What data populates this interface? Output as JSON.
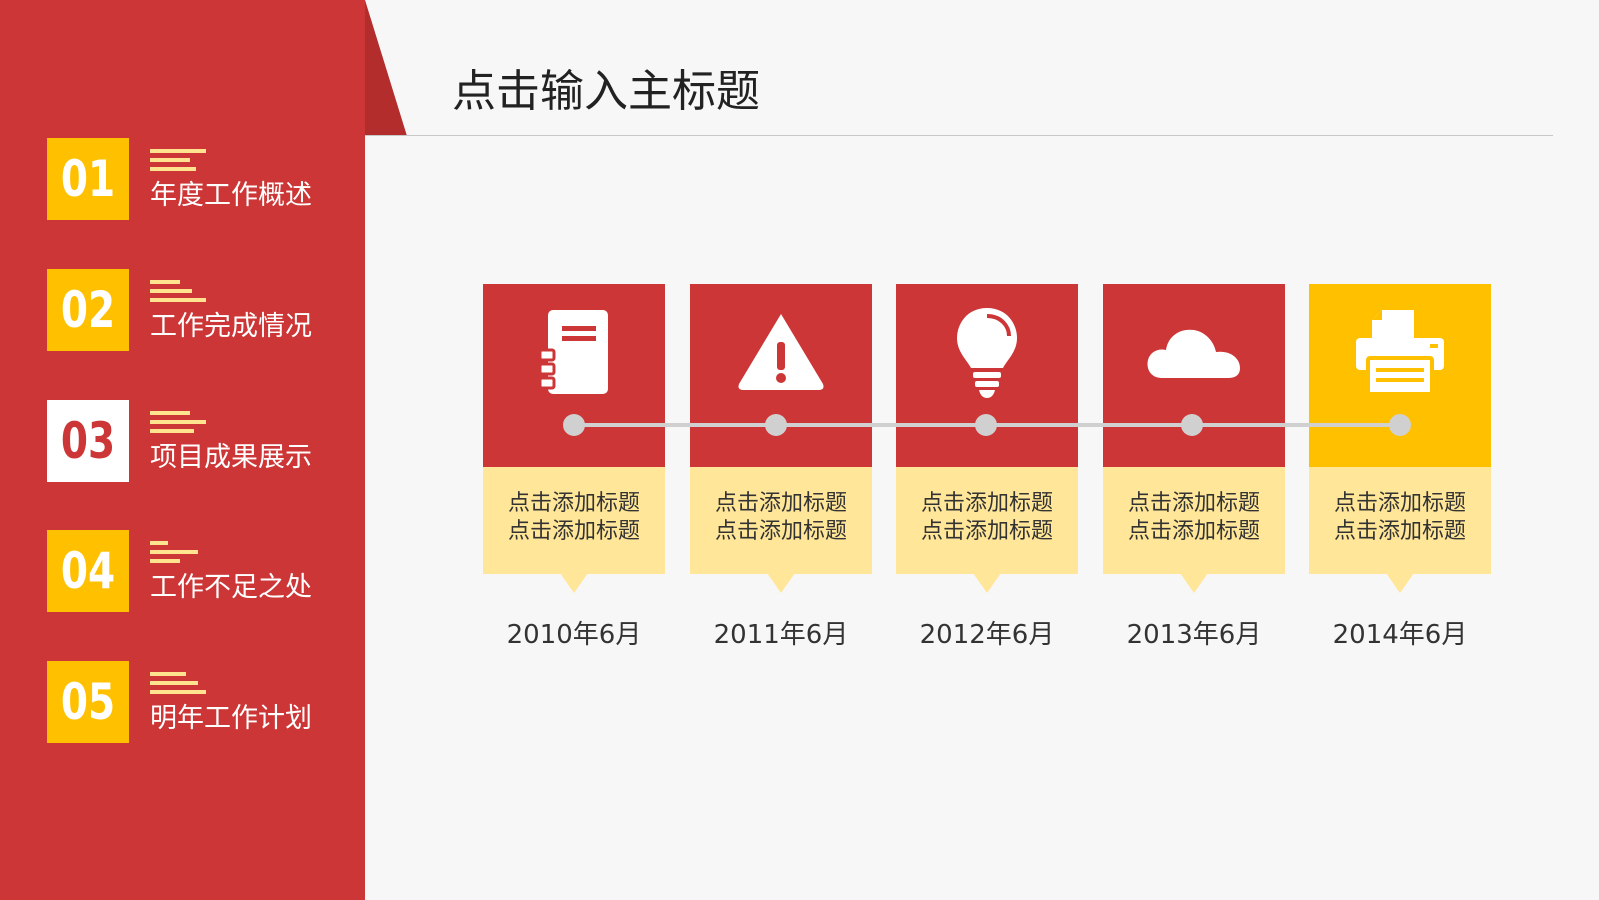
{
  "title": "点击输入主标题",
  "colors": {
    "primary_red": "#cc3636",
    "accent_yellow": "#ffc000",
    "light_yellow": "#ffe698",
    "timeline_gray": "#d0d0d0"
  },
  "menu": [
    {
      "num": "01",
      "label": "年度工作概述",
      "active": false
    },
    {
      "num": "02",
      "label": "工作完成情况",
      "active": false
    },
    {
      "num": "03",
      "label": "项目成果展示",
      "active": true
    },
    {
      "num": "04",
      "label": "工作不足之处",
      "active": false
    },
    {
      "num": "05",
      "label": "明年工作计划",
      "active": false
    }
  ],
  "cards": [
    {
      "icon": "notebook-icon",
      "text": "点击添加标题\n点击添加标题",
      "date": "2010年6月",
      "accent": false
    },
    {
      "icon": "warning-icon",
      "text": "点击添加标题\n点击添加标题",
      "date": "2011年6月",
      "accent": false
    },
    {
      "icon": "lightbulb-icon",
      "text": "点击添加标题\n点击添加标题",
      "date": "2012年6月",
      "accent": false
    },
    {
      "icon": "cloud-icon",
      "text": "点击添加标题\n点击添加标题",
      "date": "2013年6月",
      "accent": false
    },
    {
      "icon": "printer-icon",
      "text": "点击添加标题\n点击添加标题",
      "date": "2014年6月",
      "accent": true
    }
  ]
}
